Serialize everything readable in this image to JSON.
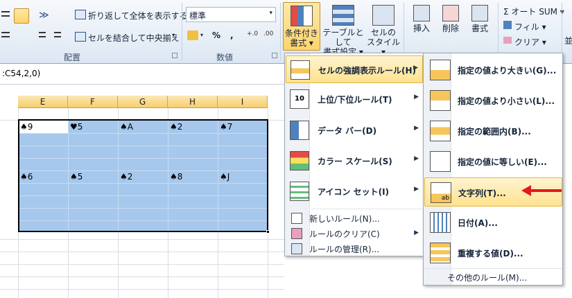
{
  "ribbon": {
    "wrap_text": "折り返して全体を表示する",
    "merge_center": "セルを結合して中央揃え",
    "number_format": "標準",
    "percent": "%",
    "comma": ",",
    "alignment_group": "配置",
    "number_group": "数値",
    "conditional_format": [
      "条件付き",
      "書式 ▾"
    ],
    "format_as_table": [
      "テーブルとして",
      "書式設定 ▾"
    ],
    "cell_styles": [
      "セルの",
      "スタイル ▾"
    ],
    "insert": "挿入",
    "delete": "削除",
    "format": "書式",
    "autosum": "Σ オート SUM ▾",
    "fill": "フィル ▾",
    "clear": "クリア ▾",
    "edge_label": "並"
  },
  "formula_bar": {
    "text": ":C54,2,0)"
  },
  "columns": [
    "E",
    "F",
    "G",
    "H",
    "I"
  ],
  "cells": {
    "row1": [
      "♠9",
      "♥5",
      "♠A",
      "♠2",
      "♠7"
    ],
    "row2": [
      "♠6",
      "♠5",
      "♠2",
      "♠8",
      "♠J"
    ]
  },
  "menu": {
    "items": [
      {
        "label": "セルの強調表示ルール(H)",
        "highlighted": true
      },
      {
        "label": "上位/下位ルール(T)"
      },
      {
        "label": "データ バー(D)"
      },
      {
        "label": "カラー スケール(S)"
      },
      {
        "label": "アイコン セット(I)"
      }
    ],
    "small_items": [
      "新しいルール(N)...",
      "ルールのクリア(C)",
      "ルールの管理(R)..."
    ]
  },
  "submenu": {
    "items": [
      "指定の値より大きい(G)...",
      "指定の値より小さい(L)...",
      "指定の範囲内(B)...",
      "指定の値に等しい(E)...",
      "文字列(T)...",
      "日付(A)...",
      "重複する値(D)..."
    ],
    "highlighted_index": 4,
    "footer": "その他のルール(M)..."
  },
  "colors": {
    "selection": "#a6c8ec",
    "highlight": "#ffe28d",
    "arrow": "#e0191c"
  }
}
